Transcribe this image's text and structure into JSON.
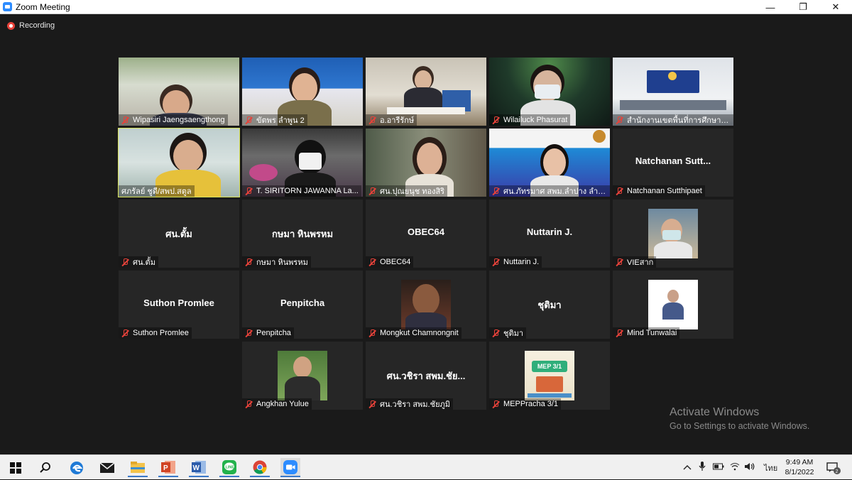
{
  "window": {
    "title": "Zoom Meeting",
    "minimize": "—",
    "maximize": "❐",
    "close": "✕"
  },
  "recording": {
    "label": "Recording"
  },
  "tiles": [
    {
      "name": "Wipasiri Jaengsaengthong",
      "display": "",
      "kind": "video"
    },
    {
      "name": "ขัตพร ลำพูน 2",
      "display": "",
      "kind": "video"
    },
    {
      "name": "อ.อารีรักษ์",
      "display": "",
      "kind": "video"
    },
    {
      "name": "Wilailuck Phasurat",
      "display": "",
      "kind": "video"
    },
    {
      "name": "สำนักงานเขตพื้นที่การศึกษาประ...",
      "display": "",
      "kind": "video"
    },
    {
      "name": "ศภรัลย์ ชูดี/สพป.สตูล",
      "display": "",
      "kind": "video",
      "active": true
    },
    {
      "name": "T. SIRITORN JAWANNA La...",
      "display": "",
      "kind": "video"
    },
    {
      "name": "ศน.ปุณยนุช ทองสิริ",
      "display": "",
      "kind": "video"
    },
    {
      "name": "ศน.ภัทรมาศ สพม.ลำปาง ลำพูน",
      "display": "",
      "kind": "video"
    },
    {
      "name": "Natchanan Sutthipaet",
      "display": "Natchanan  Sutt...",
      "kind": "text"
    },
    {
      "name": "ศน.ตั้ม",
      "display": "ศน.ตั้ม",
      "kind": "text"
    },
    {
      "name": "กษมา หินพรหม",
      "display": "กษมา หินพรหม",
      "kind": "text"
    },
    {
      "name": "OBEC64",
      "display": "OBEC64",
      "kind": "text"
    },
    {
      "name": "Nuttarin J.",
      "display": "Nuttarin J.",
      "kind": "text"
    },
    {
      "name": "VIEสาก",
      "display": "",
      "kind": "photo"
    },
    {
      "name": "Suthon Promlee",
      "display": "Suthon Promlee",
      "kind": "text"
    },
    {
      "name": "Penpitcha",
      "display": "Penpitcha",
      "kind": "text"
    },
    {
      "name": "Mongkut Chamnongnit",
      "display": "",
      "kind": "photo"
    },
    {
      "name": "ชุติมา",
      "display": "ชุติมา",
      "kind": "text"
    },
    {
      "name": "Mind Tunwalai",
      "display": "",
      "kind": "photo"
    },
    {
      "name": "Angkhan Yulue",
      "display": "",
      "kind": "photo"
    },
    {
      "name": "ศน.วชิรา สพม.ชัยภูมิ",
      "display": "ศน.วชิรา สพม.ชัย...",
      "kind": "text"
    },
    {
      "name": "MEPPracha 3/1",
      "display": "",
      "kind": "photo",
      "caption": "MEP 3/1"
    }
  ],
  "watermark": {
    "line1": "Activate Windows",
    "line2": "Go to Settings to activate Windows."
  },
  "taskbar": {
    "lang": "ไทย",
    "time": "9:49 AM",
    "date": "8/1/2022",
    "notifications": "2",
    "apps": [
      "windows-start",
      "search",
      "edge",
      "mail",
      "file-explorer",
      "powerpoint",
      "word",
      "line",
      "chrome",
      "zoom"
    ]
  },
  "colors": {
    "recording": "#e8423a",
    "active_speaker": "#d9e35a",
    "zoom_blue": "#2d8cff",
    "background": "#1a1a1a",
    "tile": "#262626"
  }
}
